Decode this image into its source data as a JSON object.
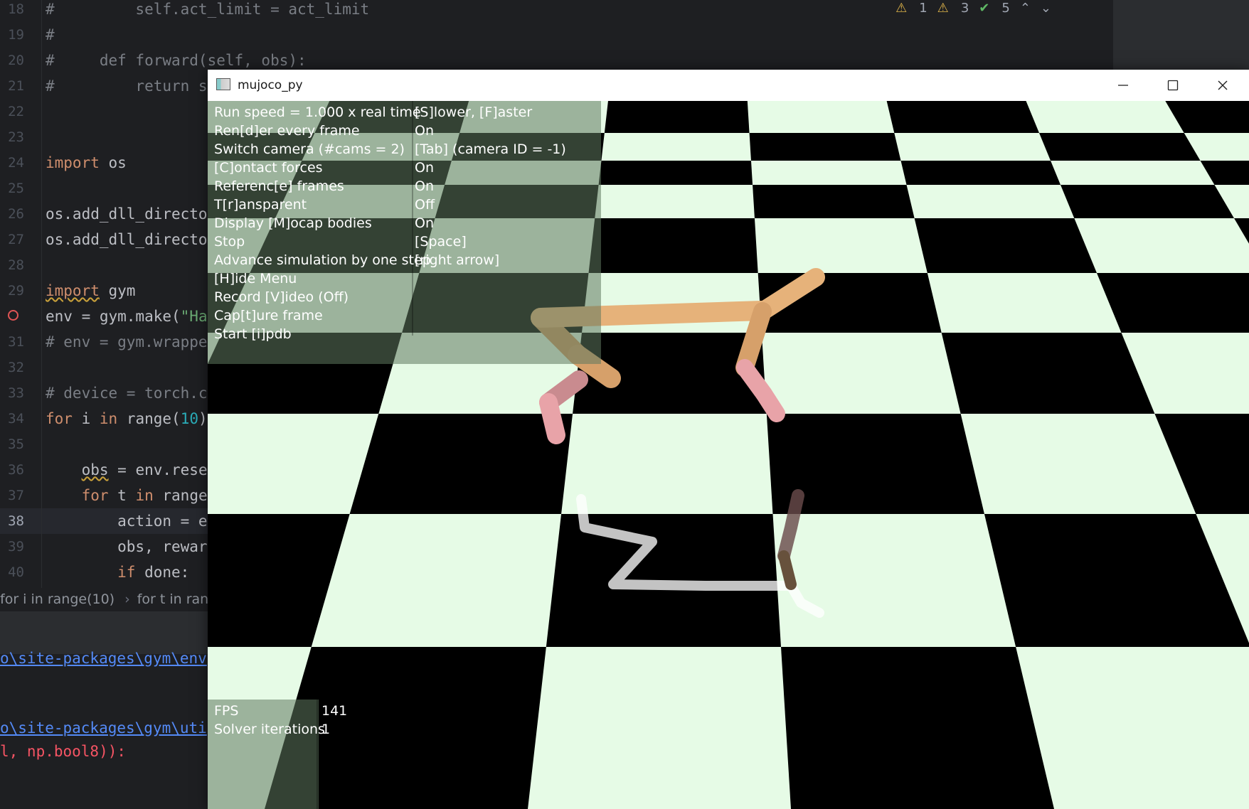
{
  "editor": {
    "lines": [
      {
        "n": "18",
        "html": "<span class='cm'>#         self.act_limit = act_limit</span>"
      },
      {
        "n": "19",
        "html": "<span class='cm'>#</span>"
      },
      {
        "n": "20",
        "html": "<span class='cm'>#     def forward(self, obs):</span>"
      },
      {
        "n": "21",
        "html": "<span class='cm'>#         return s</span>"
      },
      {
        "n": "22",
        "html": ""
      },
      {
        "n": "23",
        "html": ""
      },
      {
        "n": "24",
        "html": "<span class='kw'>import</span> os"
      },
      {
        "n": "25",
        "html": ""
      },
      {
        "n": "26",
        "html": "os.add_dll_directo"
      },
      {
        "n": "27",
        "html": "os.add_dll_directo"
      },
      {
        "n": "28",
        "html": ""
      },
      {
        "n": "29",
        "html": "<span class='kw squig'>import</span> gym"
      },
      {
        "n": "30",
        "html": "env = gym.make(<span class='str'>\"Ha</span>",
        "breakpoint": true
      },
      {
        "n": "31",
        "html": "<span class='cm'># env = gym.wrappe</span>"
      },
      {
        "n": "32",
        "html": ""
      },
      {
        "n": "33",
        "html": "<span class='cm'># device = torch.c</span>"
      },
      {
        "n": "34",
        "html": "<span class='kw'>for</span> i <span class='kw'>in</span> range(<span class='num'>10</span>)"
      },
      {
        "n": "35",
        "html": ""
      },
      {
        "n": "36",
        "html": "    <span class='squig'>obs</span> = env.rese"
      },
      {
        "n": "37",
        "html": "    <span class='kw'>for</span> t <span class='kw'>in</span> range"
      },
      {
        "n": "38",
        "html": "        action = e",
        "current": true
      },
      {
        "n": "39",
        "html": "        obs, rewar"
      },
      {
        "n": "40",
        "html": "        <span class='kw'>if</span> done:"
      }
    ],
    "inspections": {
      "warn_a": "1",
      "warn_b": "3",
      "ok": "5"
    },
    "breadcrumbs": [
      "for i in range(10)",
      "for t in range"
    ]
  },
  "console": {
    "line1": "o\\site-packages\\gym\\env",
    "line2": "o\\site-packages\\gym\\uti",
    "line3": "l, np.bool8)):"
  },
  "window": {
    "title": "mujoco_py"
  },
  "overlay": {
    "menu": [
      {
        "label": "Run speed = 1.000 x real time",
        "value": "[S]lower, [F]aster"
      },
      {
        "label": "Ren[d]er every frame",
        "value": "On"
      },
      {
        "label": "Switch camera (#cams = 2)",
        "value": "[Tab] (camera ID = -1)"
      },
      {
        "label": "[C]ontact forces",
        "value": "On"
      },
      {
        "label": "Referenc[e] frames",
        "value": "On"
      },
      {
        "label": "T[r]ansparent",
        "value": "Off"
      },
      {
        "label": "Display [M]ocap bodies",
        "value": "On"
      },
      {
        "label": "Stop",
        "value": "[Space]"
      },
      {
        "label": "Advance simulation by one step",
        "value": "[right arrow]"
      },
      {
        "label": "[H]ide Menu",
        "value": ""
      },
      {
        "label": "Record [V]ideo (Off)",
        "value": ""
      },
      {
        "label": "Cap[t]ure frame",
        "value": ""
      },
      {
        "label": "Start [i]pdb",
        "value": ""
      }
    ],
    "stats": [
      {
        "label": "FPS",
        "value": "141"
      },
      {
        "label": "Solver iterations",
        "value": "1"
      }
    ]
  },
  "colors": {
    "floor_light": "#e6fbe6",
    "floor_dark": "#000000",
    "body_tan": "#e6b27a",
    "body_pink": "#e8a3a8"
  }
}
